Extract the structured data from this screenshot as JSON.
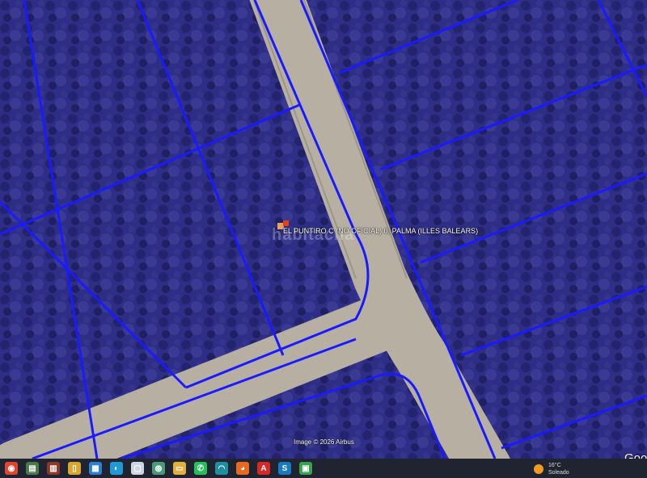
{
  "map": {
    "parcel_label": "EL PUNTIRO C (NO OFICIAL) 0, PALMA (ILLES BALEARS)",
    "watermark": "habitaclia",
    "attribution": "Image © 2026 Airbus",
    "provider_logo": "Goog",
    "marker_icon": "property-marker-icon",
    "colors": {
      "parcel_line": "#1a1aff",
      "road": "#b7b0a2",
      "vegetation": "#2e2e86"
    }
  },
  "taskbar": {
    "apps": [
      {
        "name": "chrome-icon",
        "glyph": "◉",
        "color": "#e0452f"
      },
      {
        "name": "spreadsheet-app-icon",
        "glyph": "▤",
        "color": "#4a7a4a"
      },
      {
        "name": "presentation-app-icon",
        "glyph": "▥",
        "color": "#8a3a2a"
      },
      {
        "name": "file-explorer-icon",
        "glyph": "▯",
        "color": "#d9a830"
      },
      {
        "name": "photos-app-icon",
        "glyph": "▦",
        "color": "#2f7fd0"
      },
      {
        "name": "edge-browser-icon",
        "glyph": "◐",
        "color": "#1f9ad6"
      },
      {
        "name": "document-icon",
        "glyph": "▢",
        "color": "#cfd6e0"
      },
      {
        "name": "globe-app-icon",
        "glyph": "◍",
        "color": "#4a9a7a"
      },
      {
        "name": "folder-icon",
        "glyph": "▭",
        "color": "#e0b040"
      },
      {
        "name": "whatsapp-icon",
        "glyph": "✆",
        "color": "#25c25a"
      },
      {
        "name": "wifi-app-icon",
        "glyph": "◠",
        "color": "#1f8fa0"
      },
      {
        "name": "firefox-icon",
        "glyph": "◕",
        "color": "#e86a20"
      },
      {
        "name": "acrobat-icon",
        "glyph": "A",
        "color": "#d62828"
      },
      {
        "name": "scribus-icon",
        "glyph": "S",
        "color": "#1a7ac0"
      },
      {
        "name": "green-app-icon",
        "glyph": "▣",
        "color": "#3aa050"
      }
    ]
  },
  "weather": {
    "temperature": "16°C",
    "condition": "Soleado",
    "icon": "sun-icon"
  }
}
